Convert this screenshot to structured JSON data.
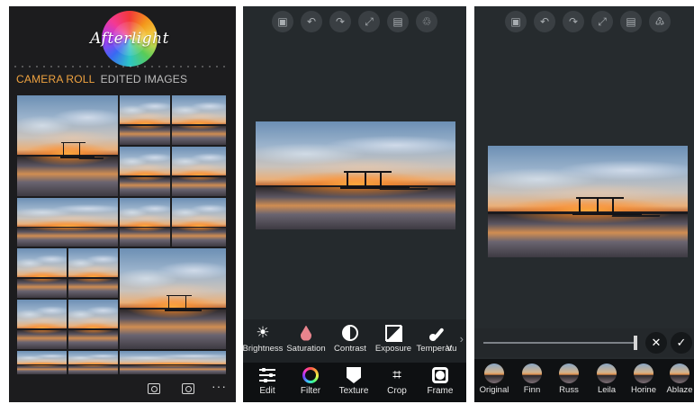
{
  "panel1": {
    "logo_text": "Afterlight",
    "tabs": [
      {
        "label": "CAMERA ROLL",
        "active": true
      },
      {
        "label": "EDITED IMAGES",
        "active": false
      }
    ],
    "bottom_more": "···"
  },
  "panel2": {
    "tools": [
      {
        "label": "Brightness",
        "icon": "sun-icon"
      },
      {
        "label": "Saturation",
        "icon": "drop-icon"
      },
      {
        "label": "Contrast",
        "icon": "contrast-icon"
      },
      {
        "label": "Exposure",
        "icon": "exposure-icon"
      },
      {
        "label": "Temperatu",
        "icon": "thermometer-icon"
      },
      {
        "label": "V",
        "icon": "more-tool-icon"
      }
    ],
    "tools_arrow": "›",
    "nav": [
      {
        "label": "Edit",
        "icon": "edit-sliders-icon"
      },
      {
        "label": "Filter",
        "icon": "filter-ring-icon"
      },
      {
        "label": "Texture",
        "icon": "texture-icon"
      },
      {
        "label": "Crop",
        "icon": "crop-icon"
      },
      {
        "label": "Frame",
        "icon": "frame-icon"
      }
    ]
  },
  "panel3": {
    "slider_value": 1.0,
    "cancel_glyph": "✕",
    "confirm_glyph": "✓",
    "filters": [
      "Original",
      "Finn",
      "Russ",
      "Leila",
      "Horine",
      "Ablaze"
    ]
  },
  "toolbar_glyphs": {
    "photo": "▣",
    "undo": "↶",
    "redo": "↷",
    "fullscreen": "⤢",
    "save": "▤",
    "share2": "♲",
    "share3": "♳"
  }
}
